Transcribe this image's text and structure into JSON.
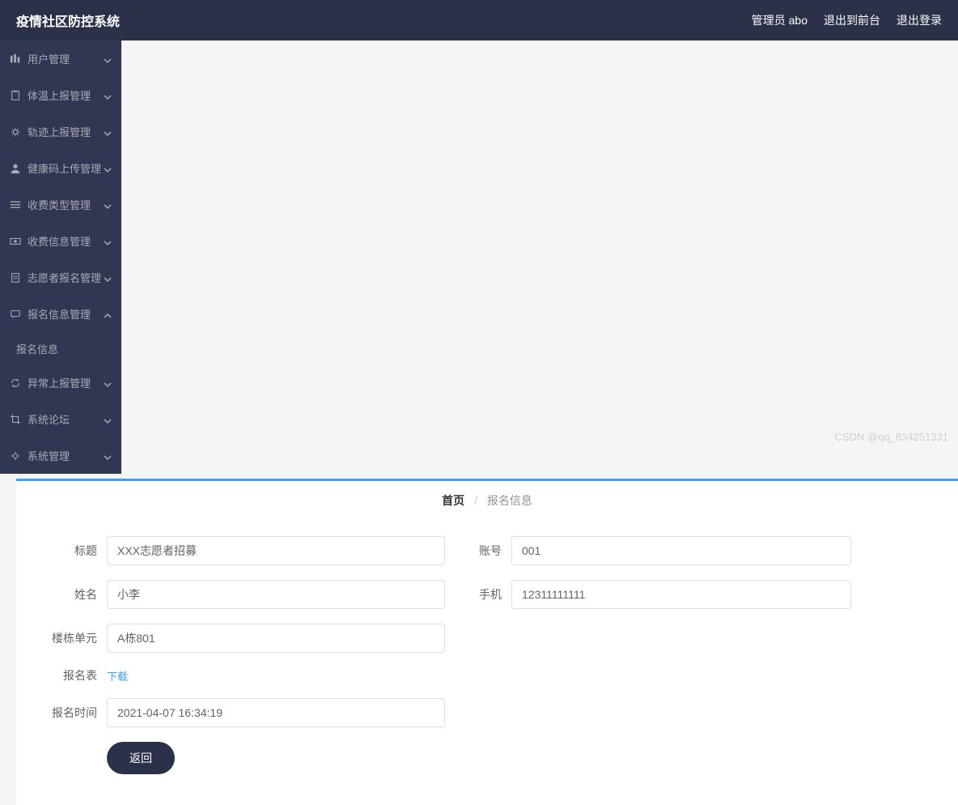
{
  "header": {
    "title": "疫情社区防控系统",
    "admin_label": "管理员 abo",
    "back_label": "退出到前台",
    "logout_label": "退出登录"
  },
  "sidebar": {
    "items": [
      {
        "label": "用户管理",
        "icon": "bars"
      },
      {
        "label": "体温上报管理",
        "icon": "clipboard"
      },
      {
        "label": "轨迹上报管理",
        "icon": "gear"
      },
      {
        "label": "健康码上传管理",
        "icon": "user"
      },
      {
        "label": "收费类型管理",
        "icon": "list"
      },
      {
        "label": "收费信息管理",
        "icon": "money"
      },
      {
        "label": "志愿者报名管理",
        "icon": "clipboard"
      },
      {
        "label": "报名信息管理",
        "icon": "chat",
        "expanded": true
      },
      {
        "label": "异常上报管理",
        "icon": "refresh"
      },
      {
        "label": "系统论坛",
        "icon": "crop"
      },
      {
        "label": "系统管理",
        "icon": "gear"
      }
    ],
    "submenu_label": "报名信息"
  },
  "breadcrumb": {
    "home": "首页",
    "current": "报名信息"
  },
  "form": {
    "title_label": "标题",
    "title_value": "XXX志愿者招募",
    "account_label": "账号",
    "account_value": "001",
    "name_label": "姓名",
    "name_value": "小李",
    "phone_label": "手机",
    "phone_value": "12311111111",
    "building_label": "楼栋单元",
    "building_value": "A栋801",
    "form_table_label": "报名表",
    "download_text": "下载",
    "time_label": "报名时间",
    "time_value": "2021-04-07 16:34:19",
    "return_button": "返回"
  },
  "watermark": "CSDN @qq_834251331"
}
